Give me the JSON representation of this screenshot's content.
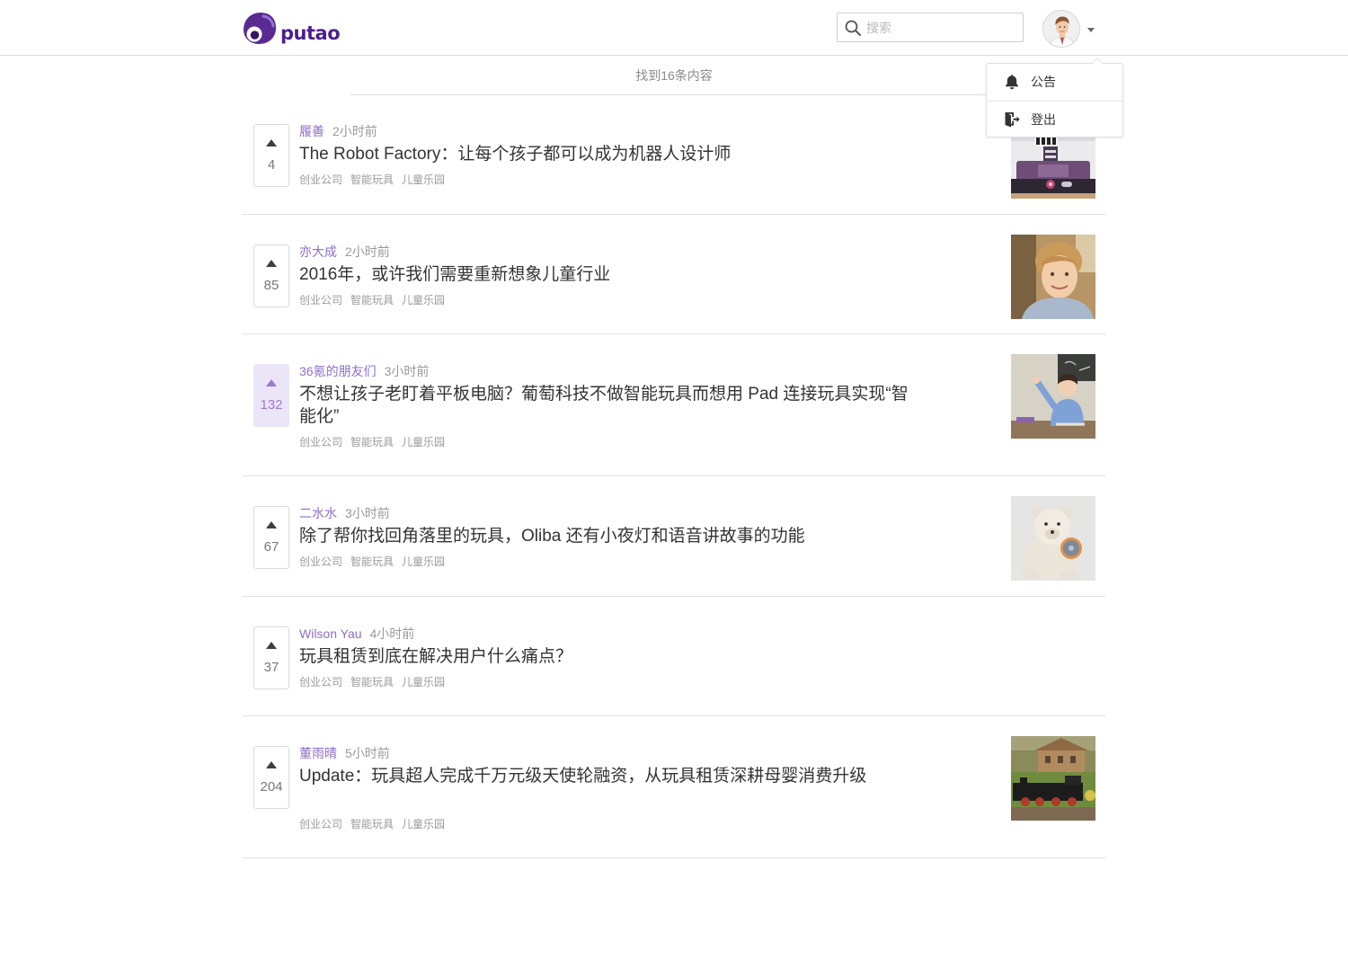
{
  "header": {
    "logo_text": "putao",
    "logo_icon": "putao-logo-icon",
    "search": {
      "placeholder": "搜索",
      "icon": "search-icon"
    },
    "user_menu": {
      "caret_icon": "caret-down-icon",
      "items": [
        {
          "icon": "bell-icon",
          "label": "公告"
        },
        {
          "icon": "logout-icon",
          "label": "登出"
        }
      ]
    }
  },
  "results": {
    "summary": "找到16条内容"
  },
  "posts": [
    {
      "author": "履善",
      "time": "2小时前",
      "title": "The Robot Factory：让每个孩子都可以成为机器人设计师",
      "tags": [
        "创业公司",
        "智能玩具",
        "儿童乐园"
      ],
      "votes": 4,
      "voted": false
    },
    {
      "author": "亦大成",
      "time": "2小时前",
      "title": "2016年，或许我们需要重新想象儿童行业",
      "tags": [
        "创业公司",
        "智能玩具",
        "儿童乐园"
      ],
      "votes": 85,
      "voted": false
    },
    {
      "author": "36氪的朋友们",
      "time": "3小时前",
      "title": "不想让孩子老盯着平板电脑？葡萄科技不做智能玩具而想用 Pad 连接玩具实现“智能化”",
      "tags": [
        "创业公司",
        "智能玩具",
        "儿童乐园"
      ],
      "votes": 132,
      "voted": true
    },
    {
      "author": "二水水",
      "time": "3小时前",
      "title": "除了帮你找回角落里的玩具，Oliba 还有小夜灯和语音讲故事的功能",
      "tags": [
        "创业公司",
        "智能玩具",
        "儿童乐园"
      ],
      "votes": 67,
      "voted": false
    },
    {
      "author": "Wilson Yau",
      "time": "4小时前",
      "title": "玩具租赁到底在解决用户什么痛点？",
      "tags": [
        "创业公司",
        "智能玩具",
        "儿童乐园"
      ],
      "votes": 37,
      "voted": false
    },
    {
      "author": "董雨晴",
      "time": "5小时前",
      "title": "Update：玩具超人完成千万元级天使轮融资，从玩具租赁深耕母婴消费升级",
      "tags": [
        "创业公司",
        "智能玩具",
        "儿童乐园"
      ],
      "votes": 204,
      "voted": false
    }
  ],
  "colors": {
    "brand": "#4e1f8c",
    "accent": "#8d6eca",
    "voted_bg": "#ece5f8",
    "voted_fg": "#9a7bd3",
    "text": "#333333",
    "muted": "#9a9a9a",
    "border": "#e2e2e2"
  }
}
